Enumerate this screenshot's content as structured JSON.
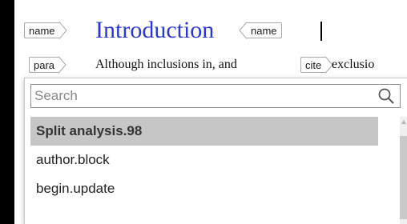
{
  "heading": {
    "open_tag": "name",
    "title": "Introduction",
    "close_tag": "name"
  },
  "paragraph": {
    "para_tag": "para",
    "text": "Although inclusions in, and",
    "cite_tag": "cite",
    "text_after": "exclusio"
  },
  "search": {
    "placeholder": "Search",
    "icon": "search-icon"
  },
  "items": [
    {
      "label": "Split analysis.98",
      "selected": true
    },
    {
      "label": "author.block",
      "selected": false
    },
    {
      "label": "begin.update",
      "selected": false
    }
  ],
  "colors": {
    "title": "#2a37d6",
    "selected_bg": "#c6c6c6",
    "background": "#000000"
  }
}
